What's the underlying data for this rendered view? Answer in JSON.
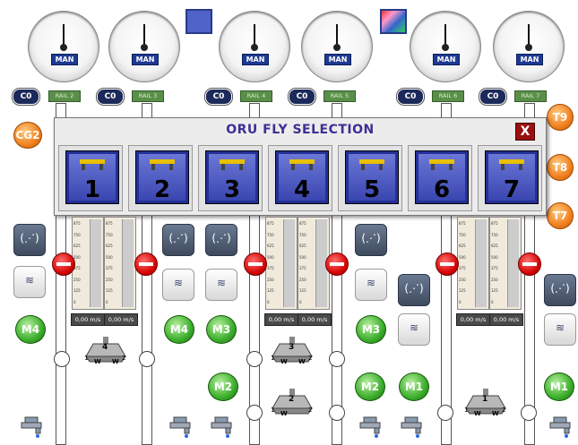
{
  "gauges": [
    {
      "mode": "MAN"
    },
    {
      "mode": "MAN"
    },
    {
      "mode": "MAN"
    },
    {
      "mode": "MAN"
    },
    {
      "mode": "MAN"
    },
    {
      "mode": "MAN"
    }
  ],
  "rails": [
    {
      "co": "C0",
      "label": "RAIL 2"
    },
    {
      "co": "C0",
      "label": "RAIL 3"
    },
    {
      "co": "C0",
      "label": "RAIL 4"
    },
    {
      "co": "C0",
      "label": "RAIL 5"
    },
    {
      "co": "C0",
      "label": "RAIL 6"
    },
    {
      "co": "C0",
      "label": "RAIL 7"
    }
  ],
  "side_badges": {
    "cg2": "CG2",
    "t9": "T9",
    "t8": "T8",
    "t7": "T7"
  },
  "motors": {
    "m4a": "M4",
    "m4b": "M4",
    "m3a": "M3",
    "m3b": "M3",
    "m2a": "M2",
    "m2b": "M2",
    "m1a": "M1",
    "m1b": "M1"
  },
  "dialog": {
    "title": "ORU FLY SELECTION",
    "close": "X",
    "slots": [
      "1",
      "2",
      "3",
      "4",
      "5",
      "6",
      "7"
    ]
  },
  "speeds": [
    "0,00 m/s",
    "0,00 m/s",
    "0,00 m/s",
    "0,00 m/s",
    "0,00 m/s",
    "0,00 m/s"
  ],
  "scale_ticks": [
    "875",
    "750",
    "625",
    "500",
    "375",
    "250",
    "125",
    "0"
  ],
  "hoists": [
    {
      "num": "4",
      "l": "1",
      "r": "2",
      "w1": "W",
      "w2": "W"
    },
    {
      "num": "3",
      "l": "1",
      "r": "2",
      "w1": "W",
      "w2": "W"
    },
    {
      "num": "2",
      "l": "1",
      "r": "2",
      "w1": "W",
      "w2": ""
    },
    {
      "num": "1",
      "l": "1",
      "r": "2",
      "w1": "W",
      "w2": "W"
    }
  ],
  "colors": {
    "dialog_title": "#3b2f95",
    "slot_button": "#4a56c0",
    "close": "#9a1010",
    "orange": "#f08020",
    "green": "#3cae2c"
  }
}
